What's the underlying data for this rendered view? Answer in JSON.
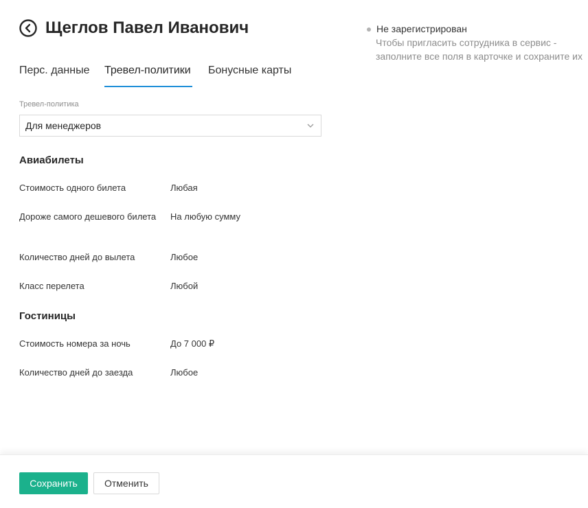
{
  "header": {
    "title": "Щеглов Павел Иванович",
    "back_icon": "arrow-left-circle-icon"
  },
  "status": {
    "title": "Не зарегистрирован",
    "hint": "Чтобы пригласить сотрудника в сервис - заполните все поля в карточке и сохраните их",
    "dot_color": "#b3b3b3"
  },
  "tabs": [
    {
      "label": "Перс. данные",
      "active": false
    },
    {
      "label": "Тревел-политики",
      "active": true
    },
    {
      "label": "Бонусные карты",
      "active": false
    }
  ],
  "policy_field": {
    "label": "Тревел-политика",
    "value": "Для менеджеров",
    "icon": "chevron-down-icon"
  },
  "sections": [
    {
      "title": "Авиабилеты",
      "rows": [
        {
          "label": "Стоимость одного билета",
          "value": "Любая"
        },
        {
          "label": "Дороже самого дешевого билета",
          "value": "На любую сумму"
        },
        {
          "label": "Количество дней до вылета",
          "value": "Любое"
        },
        {
          "label": "Класс перелета",
          "value": "Любой"
        }
      ]
    },
    {
      "title": "Гостиницы",
      "rows": [
        {
          "label": "Стоимость номера за ночь",
          "value": "До 7 000 ₽"
        },
        {
          "label": "Количество дней до заезда",
          "value": "Любое"
        }
      ]
    }
  ],
  "footer": {
    "save_label": "Сохранить",
    "cancel_label": "Отменить"
  },
  "colors": {
    "accent": "#1f8fd8",
    "primary_button": "#1bb18c"
  }
}
